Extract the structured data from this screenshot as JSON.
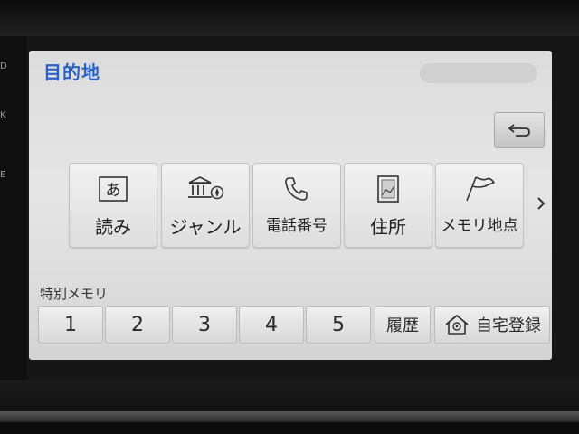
{
  "bezel": {
    "side_marks": [
      "D",
      "K",
      "E"
    ]
  },
  "header": {
    "title": "目的地"
  },
  "back_button": {
    "icon": "back-arrow-icon"
  },
  "search_methods": [
    {
      "label": "読み",
      "icon": "kana-a-icon",
      "kana": "あ"
    },
    {
      "label": "ジャンル",
      "icon": "genre-building-icon"
    },
    {
      "label": "電話番号",
      "icon": "phone-icon"
    },
    {
      "label": "住所",
      "icon": "address-map-icon"
    },
    {
      "label": "メモリ地点",
      "icon": "flag-icon"
    }
  ],
  "more_icon": "chevron-right-icon",
  "special_memory": {
    "label": "特別メモリ",
    "slots": [
      "1",
      "2",
      "3",
      "4",
      "5"
    ]
  },
  "history_button": {
    "label": "履歴"
  },
  "home_register_button": {
    "label": "自宅登録",
    "icon": "home-icon"
  },
  "colors": {
    "title": "#2a63c8",
    "screen_bg": "#e0e0e0",
    "bezel": "#161616"
  }
}
